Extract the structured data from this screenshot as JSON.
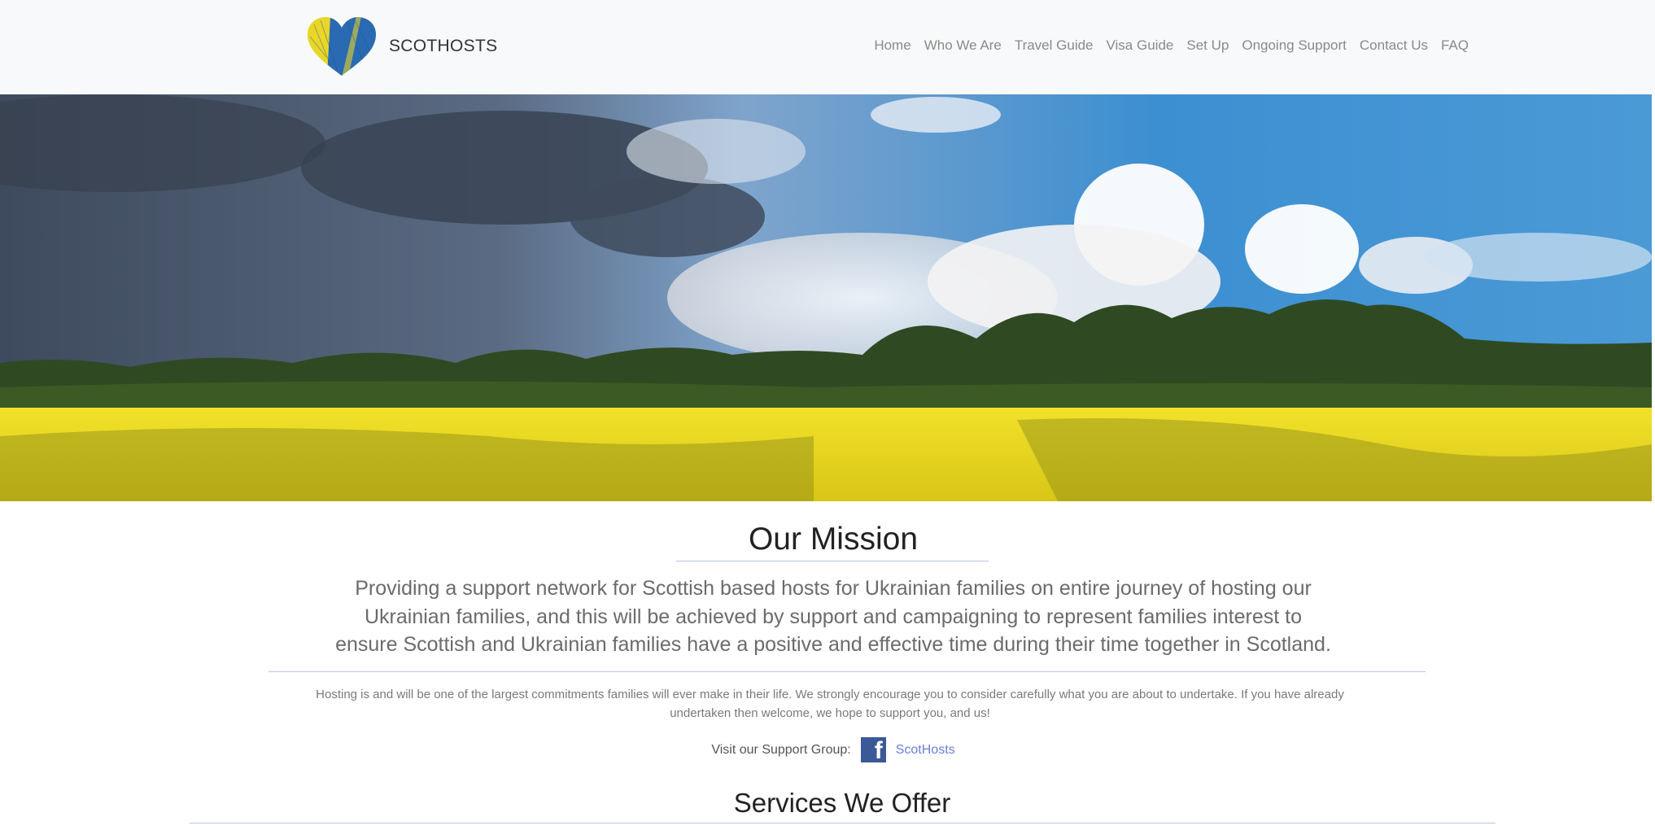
{
  "header": {
    "brand": "SCOTHOSTS",
    "nav": [
      "Home",
      "Who We Are",
      "Travel Guide",
      "Visa Guide",
      "Set Up",
      "Ongoing Support",
      "Contact Us",
      "FAQ"
    ]
  },
  "mission": {
    "title": "Our Mission",
    "text": "Providing a support network for Scottish based hosts for Ukrainian families on entire journey of hosting our Ukrainian families, and this will be achieved by support and campaigning to represent families interest to ensure Scottish and Ukrainian families have a positive and effective time during their time together in Scotland.",
    "hosting": "Hosting is and will be one of the largest commitments families will ever make in their life. We strongly encourage you to consider carefully what you are about to undertake. If you have already undertaken then welcome, we hope to support you, and us!"
  },
  "support": {
    "label": "Visit our Support Group:",
    "link": "ScotHosts",
    "icon": "facebook-icon"
  },
  "services": {
    "title": "Services We Offer"
  },
  "colors": {
    "header_bg": "#f8f9fa",
    "heart_yellow": "#e8d629",
    "heart_blue": "#2a6ab3",
    "rule": "#b9c2e6",
    "link": "#6a7fdc",
    "facebook": "#3b5998"
  }
}
